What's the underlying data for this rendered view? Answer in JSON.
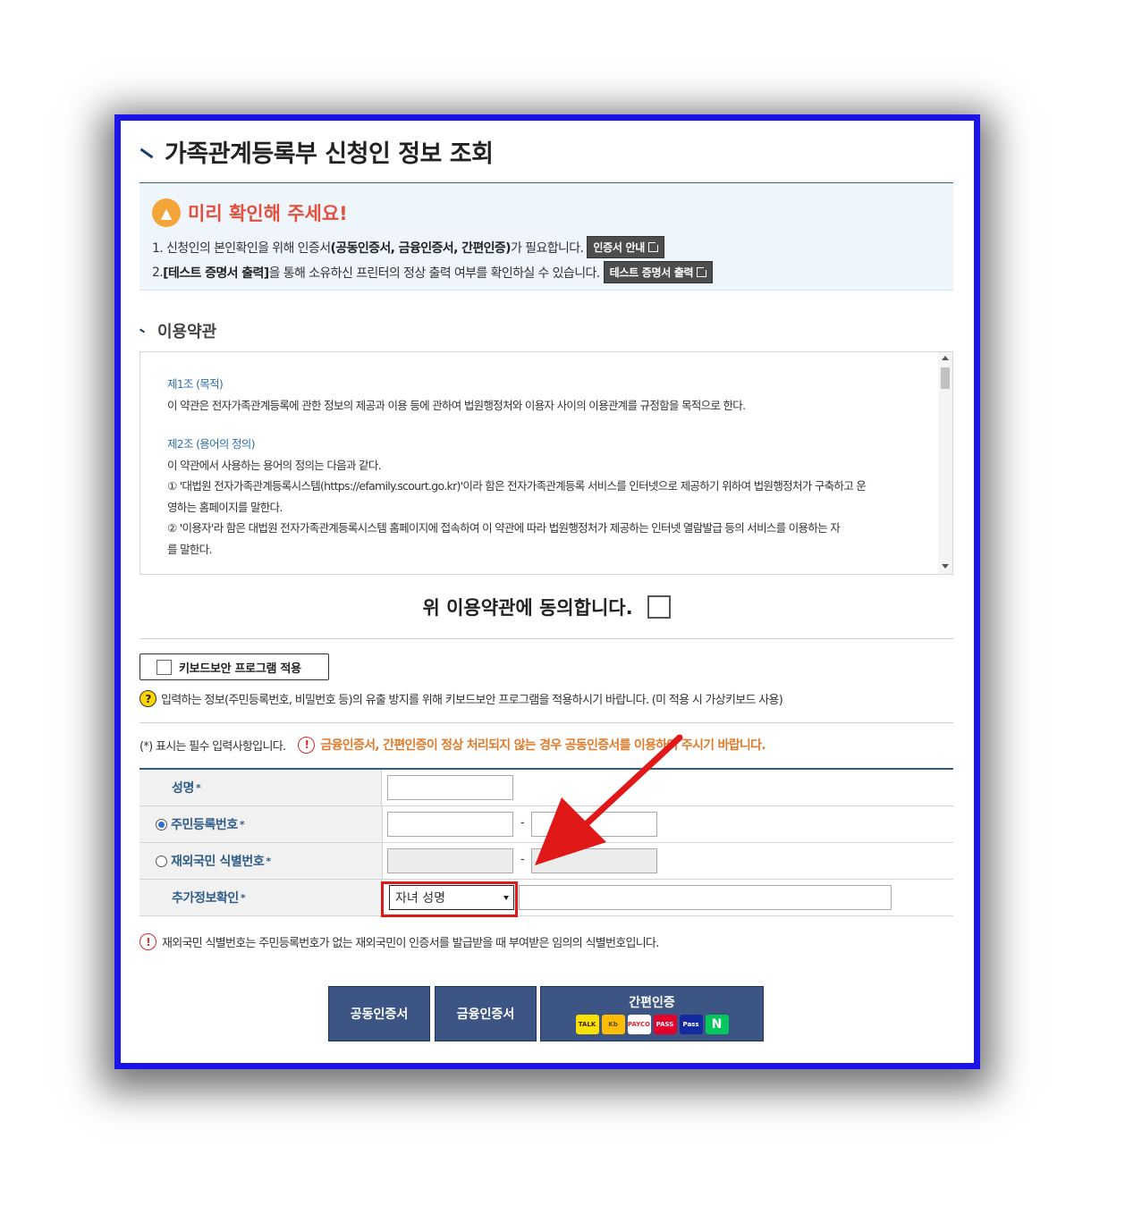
{
  "page": {
    "title": "가족관계등록부 신청인 정보 조회"
  },
  "notice": {
    "title": "미리 확인해 주세요!",
    "line1_prefix": "1. 신청인의 본인확인을 위해 인증서",
    "line1_bold": "(공동인증서, 금융인증서, 간편인증)",
    "line1_suffix": "가 필요합니다.",
    "line1_button": "인증서 안내",
    "line2_prefix": "2. ",
    "line2_bold": "[테스트 증명서 출력]",
    "line2_suffix": "을 통해 소유하신 프린터의 정상 출력 여부를 확인하실 수 있습니다.",
    "line2_button": "테스트 증명서 출력"
  },
  "terms": {
    "title": "이용약관",
    "article1_title": "제1조 (목적)",
    "article1_body": "이 약관은 전자가족관계등록에 관한 정보의 제공과 이용 등에 관하여 법원행정처와 이용자 사이의 이용관계를 규정함을 목적으로 한다.",
    "article2_title": "제2조 (용어의 정의)",
    "article2_body": "이 약관에서 사용하는 용어의 정의는 다음과 같다.",
    "article2_item1a": "① '대법원 전자가족관계등록시스템(https://efamily.scourt.go.kr)'이라 함은 전자가족관계등록 서비스를 인터넷으로 제공하기 위하여 법원행정처가 구축하고 운",
    "article2_item1b": "영하는 홈페이지를 말한다.",
    "article2_item2a": "② '이용자'라 함은 대법원 전자가족관계등록시스템 홈페이지에 접속하여 이 약관에 따라 법원행정처가 제공하는 인터넷 열람발급 등의 서비스를 이용하는 자",
    "article2_item2b": "를 말한다."
  },
  "agree": {
    "label": "위 이용약관에 동의합니다."
  },
  "keyboard": {
    "button_label": "키보드보안 프로그램 적용",
    "note": "입력하는 정보(주민등록번호, 비밀번호 등)의 유출 방지를 위해 키보드보안 프로그램을 적용하시기 바랍니다. (미 적용 시 가상키보드 사용)"
  },
  "required": {
    "note": "(*) 표시는 필수 입력사항입니다.",
    "warning": "금융인증서, 간편인증이 정상 처리되지 않는 경우 공동인증서를 이용하여 주시기 바랍니다."
  },
  "form": {
    "name_label": "성명",
    "rrn_label": "주민등록번호",
    "foreign_label": "재외국민 식별번호",
    "extra_label": "추가정보확인",
    "star": "*",
    "dash": "-",
    "extra_select_value": "자녀 성명"
  },
  "ident_note": "재외국민 식별번호는 주민등록번호가 없는 재외국민이 인증서를 발급받을 때 부여받은 임의의 식별번호입니다.",
  "auth": {
    "joint": "공동인증서",
    "financial": "금융인증서",
    "simple": "간편인증",
    "logos": {
      "talk": "TALK",
      "kb": "Kb",
      "payco": "PAYCO",
      "pass": "PASS",
      "samsung": "Pass",
      "naver": "N"
    }
  },
  "colors": {
    "frame": "#1a14e8",
    "accent": "#2f5d8a",
    "warning": "#e07b2c",
    "highlight": "#e01818",
    "button": "#3c5584"
  }
}
